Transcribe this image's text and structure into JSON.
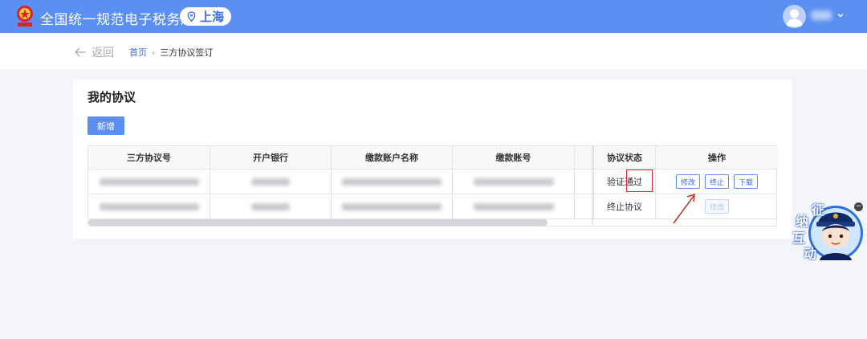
{
  "header": {
    "site_title": "全国统一规范电子税务局",
    "region": "上海",
    "logo_icon": "tax-emblem-icon",
    "user_icon": "user-avatar-icon",
    "brand_color": "#5b8ff2"
  },
  "breadcrumb": {
    "back_label": "返回",
    "home": "首页",
    "separator": "›",
    "current": "三方协议签订"
  },
  "card": {
    "title": "我的协议",
    "add_button": "新增"
  },
  "table": {
    "columns": [
      "三方协议号",
      "开户银行",
      "缴款账户名称",
      "缴款账号",
      "",
      "协议状态",
      "操作"
    ],
    "rows": [
      {
        "status": "验证通过",
        "actions": [
          "修改",
          "终止",
          "下载"
        ]
      },
      {
        "status": "终止协议",
        "actions": [
          "修改"
        ]
      }
    ]
  },
  "widget": {
    "chars": [
      "征",
      "纳",
      "互",
      "动"
    ],
    "close_symbol": "−"
  }
}
